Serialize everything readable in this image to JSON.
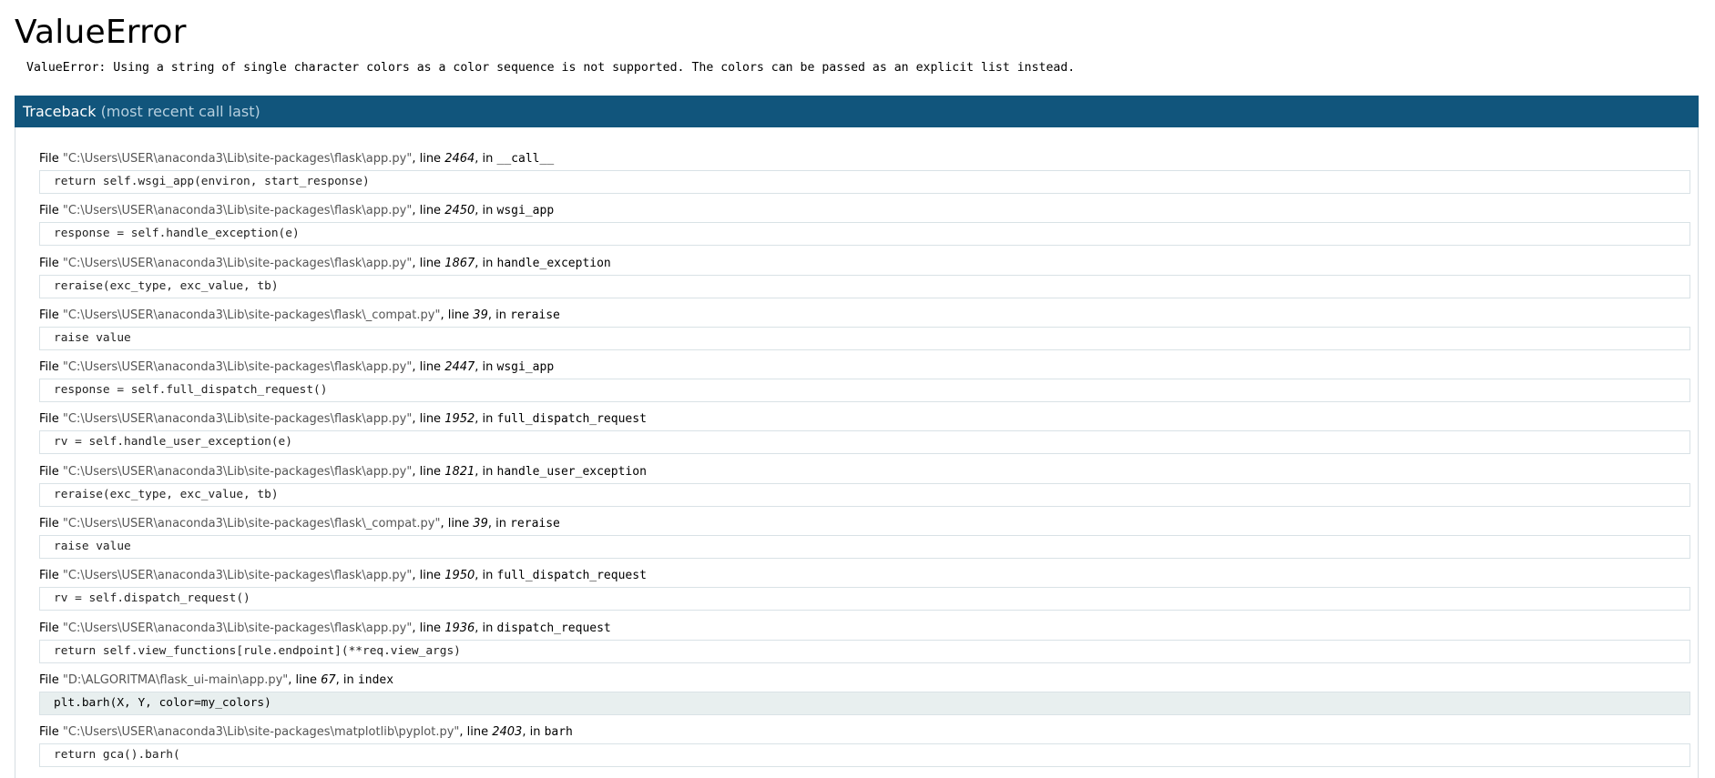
{
  "error": {
    "title": "ValueError",
    "message": "ValueError: Using a string of single character colors as a color sequence is not supported. The colors can be passed as an explicit list instead."
  },
  "traceback": {
    "title": "Traceback",
    "subtitle": "(most recent call last)",
    "frames": [
      {
        "file_label": "File ",
        "path": "\"C:\\Users\\USER\\anaconda3\\Lib\\site-packages\\flask\\app.py\"",
        "line_label": ", line ",
        "line": "2464",
        "in_label": ", in ",
        "func": "__call__",
        "code": "return self.wsgi_app(environ, start_response)"
      },
      {
        "file_label": "File ",
        "path": "\"C:\\Users\\USER\\anaconda3\\Lib\\site-packages\\flask\\app.py\"",
        "line_label": ", line ",
        "line": "2450",
        "in_label": ", in ",
        "func": "wsgi_app",
        "code": "response = self.handle_exception(e)"
      },
      {
        "file_label": "File ",
        "path": "\"C:\\Users\\USER\\anaconda3\\Lib\\site-packages\\flask\\app.py\"",
        "line_label": ", line ",
        "line": "1867",
        "in_label": ", in ",
        "func": "handle_exception",
        "code": "reraise(exc_type, exc_value, tb)"
      },
      {
        "file_label": "File ",
        "path": "\"C:\\Users\\USER\\anaconda3\\Lib\\site-packages\\flask\\_compat.py\"",
        "line_label": ", line ",
        "line": "39",
        "in_label": ", in ",
        "func": "reraise",
        "code": "raise value"
      },
      {
        "file_label": "File ",
        "path": "\"C:\\Users\\USER\\anaconda3\\Lib\\site-packages\\flask\\app.py\"",
        "line_label": ", line ",
        "line": "2447",
        "in_label": ", in ",
        "func": "wsgi_app",
        "code": "response = self.full_dispatch_request()"
      },
      {
        "file_label": "File ",
        "path": "\"C:\\Users\\USER\\anaconda3\\Lib\\site-packages\\flask\\app.py\"",
        "line_label": ", line ",
        "line": "1952",
        "in_label": ", in ",
        "func": "full_dispatch_request",
        "code": "rv = self.handle_user_exception(e)"
      },
      {
        "file_label": "File ",
        "path": "\"C:\\Users\\USER\\anaconda3\\Lib\\site-packages\\flask\\app.py\"",
        "line_label": ", line ",
        "line": "1821",
        "in_label": ", in ",
        "func": "handle_user_exception",
        "code": "reraise(exc_type, exc_value, tb)"
      },
      {
        "file_label": "File ",
        "path": "\"C:\\Users\\USER\\anaconda3\\Lib\\site-packages\\flask\\_compat.py\"",
        "line_label": ", line ",
        "line": "39",
        "in_label": ", in ",
        "func": "reraise",
        "code": "raise value"
      },
      {
        "file_label": "File ",
        "path": "\"C:\\Users\\USER\\anaconda3\\Lib\\site-packages\\flask\\app.py\"",
        "line_label": ", line ",
        "line": "1950",
        "in_label": ", in ",
        "func": "full_dispatch_request",
        "code": "rv = self.dispatch_request()"
      },
      {
        "file_label": "File ",
        "path": "\"C:\\Users\\USER\\anaconda3\\Lib\\site-packages\\flask\\app.py\"",
        "line_label": ", line ",
        "line": "1936",
        "in_label": ", in ",
        "func": "dispatch_request",
        "code": "return self.view_functions[rule.endpoint](**req.view_args)"
      },
      {
        "file_label": "File ",
        "path": "\"D:\\ALGORITMA\\flask_ui-main\\app.py\"",
        "line_label": ", line ",
        "line": "67",
        "in_label": ", in ",
        "func": "index",
        "code": "plt.barh(X, Y, color=my_colors)",
        "current": true
      },
      {
        "file_label": "File ",
        "path": "\"C:\\Users\\USER\\anaconda3\\Lib\\site-packages\\matplotlib\\pyplot.py\"",
        "line_label": ", line ",
        "line": "2403",
        "in_label": ", in ",
        "func": "barh",
        "code": "return gca().barh("
      }
    ]
  },
  "colors": {
    "header_bg": "#11557c",
    "header_sub": "#b7d0df",
    "current_line_bg": "#e8efef",
    "path_text": "#555555"
  }
}
